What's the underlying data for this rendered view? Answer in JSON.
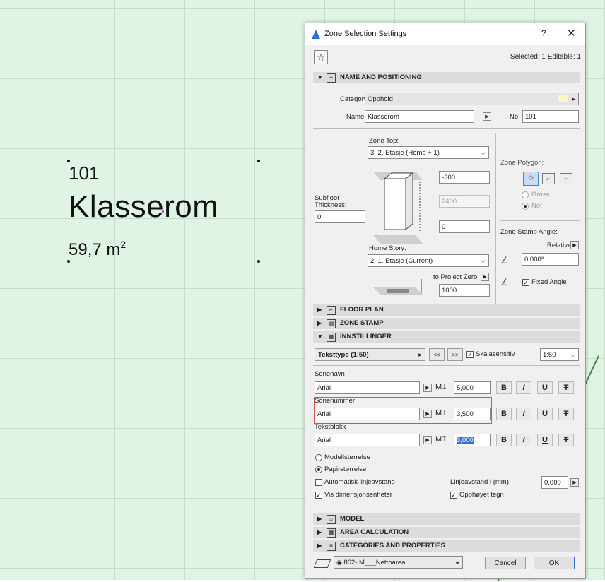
{
  "canvas": {
    "zone_number": "101",
    "zone_name": "Klasserom",
    "zone_area": "59,7 m",
    "zone_area_sup": "2"
  },
  "dialog": {
    "title": "Zone Selection Settings",
    "help_label": "?",
    "close_label": "✕",
    "selected_info": "Selected: 1 Editable: 1",
    "sections": {
      "name_positioning": "NAME AND POSITIONING",
      "floor_plan": "FLOOR PLAN",
      "zone_stamp": "ZONE STAMP",
      "innstillinger": "INNSTILLINGER",
      "model": "MODEL",
      "area_calculation": "AREA CALCULATION",
      "categories_properties": "CATEGORIES AND PROPERTIES"
    },
    "name_positioning": {
      "category_label": "Category:",
      "category_value": "Opphold",
      "name_label": "Name:",
      "name_value": "Klasserom",
      "no_label": "No:",
      "no_value": "101",
      "zone_top_label": "Zone Top:",
      "zone_top_value": "3. 2. Etasje (Home + 1)",
      "top_offset": "-300",
      "height": "2400",
      "bottom_offset": "0",
      "subfloor_label": "Subfloor Thickness:",
      "subfloor_value": "0",
      "home_story_label": "Home Story:",
      "home_story_value": "2. 1. Etasje (Current)",
      "to_project_zero_label": "to Project Zero",
      "to_project_zero_value": "1000",
      "zone_polygon_label": "Zone Polygon:",
      "gross_label": "Gross",
      "net_label": "Net",
      "stamp_angle_label": "Zone Stamp Angle:",
      "relative_label": "Relative",
      "angle_value": "0,000°",
      "fixed_angle_label": "Fixed Angle"
    },
    "innstillinger": {
      "text_type": "Teksttype (1:50)",
      "prev_label": "<<",
      "next_label": ">>",
      "scale_sensitive_label": "Skalasensitiv",
      "scale_value": "1:50",
      "rows": [
        {
          "label": "Sonenavn",
          "font": "Arial",
          "size": "5,000"
        },
        {
          "label": "Sonenummer",
          "font": "Arial",
          "size": "3,500"
        },
        {
          "label": "Tekstblokk",
          "font": "Arial",
          "size": "3,000"
        }
      ],
      "bold": "B",
      "italic": "I",
      "underline": "U",
      "strike": "T",
      "model_size_label": "Modellstørrelse",
      "paper_size_label": "Papirstørrelse",
      "auto_spacing_label": "Automatisk linjeavstand",
      "line_spacing_label": "Linjeavstand i (mm)",
      "line_spacing_value": "0,000",
      "show_units_label": "Vis dimensjonsenheter",
      "superscript_label": "Opphøyet tegn"
    },
    "footer": {
      "layer_value": "862- M___Nettoareal",
      "cancel_label": "Cancel",
      "ok_label": "OK"
    }
  }
}
